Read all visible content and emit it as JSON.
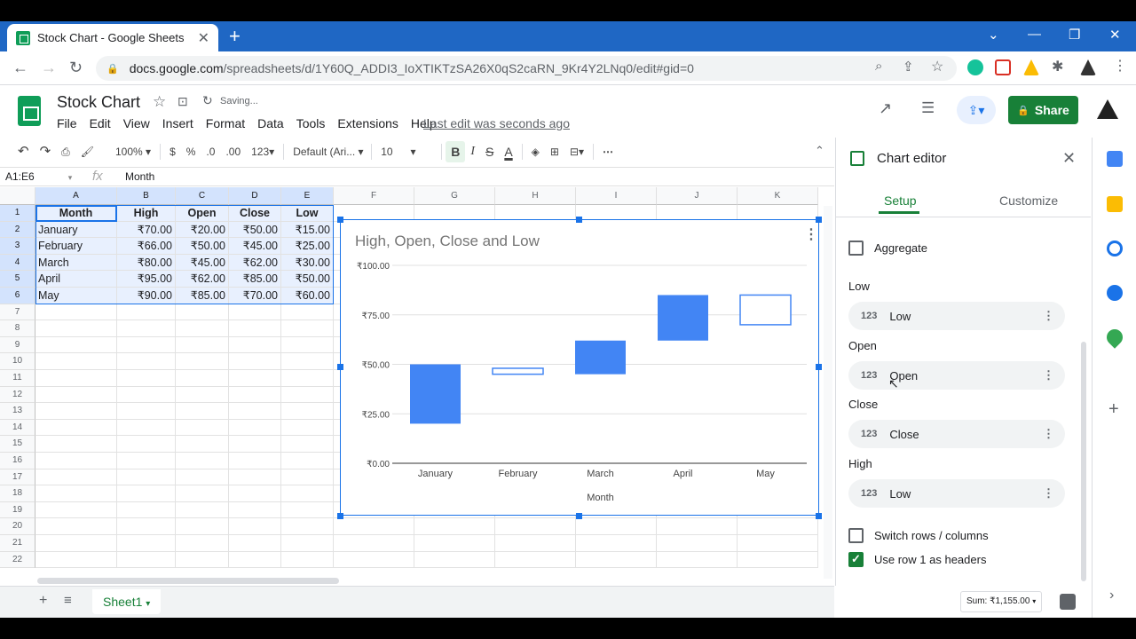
{
  "browser": {
    "tab_title": "Stock Chart - Google Sheets",
    "url_host": "docs.google.com",
    "url_path": "/spreadsheets/d/1Y60Q_ADDI3_IoXTIKTzSA26X0qS2caRN_9Kr4Y2LNq0/edit#gid=0"
  },
  "doc": {
    "title": "Stock Chart",
    "saving": "Saving...",
    "menus": [
      "File",
      "Edit",
      "View",
      "Insert",
      "Format",
      "Data",
      "Tools",
      "Extensions",
      "Help"
    ],
    "last_edit": "Last edit was seconds ago",
    "share_label": "Share"
  },
  "toolbar": {
    "zoom": "100%",
    "currency": "$",
    "percent": "%",
    "dec_less": ".0",
    "dec_more": ".00",
    "format": "123",
    "font": "Default (Ari...",
    "size": "10",
    "bold": "B",
    "italic": "I",
    "strike": "S",
    "textcolor": "A"
  },
  "formula": {
    "namebox": "A1:E6",
    "fx": "fx",
    "value": "Month"
  },
  "columns": [
    "A",
    "B",
    "C",
    "D",
    "E",
    "F",
    "G",
    "H",
    "I",
    "J",
    "K"
  ],
  "rows": [
    "1",
    "2",
    "3",
    "4",
    "5",
    "6",
    "7",
    "8",
    "9",
    "10",
    "11",
    "12",
    "13",
    "14",
    "15",
    "16",
    "17",
    "18",
    "19",
    "20",
    "21",
    "22"
  ],
  "table": {
    "headers": [
      "Month",
      "High",
      "Open",
      "Close",
      "Low"
    ],
    "rows": [
      [
        "January",
        "₹70.00",
        "₹20.00",
        "₹50.00",
        "₹15.00"
      ],
      [
        "February",
        "₹66.00",
        "₹50.00",
        "₹45.00",
        "₹25.00"
      ],
      [
        "March",
        "₹80.00",
        "₹45.00",
        "₹62.00",
        "₹30.00"
      ],
      [
        "April",
        "₹95.00",
        "₹62.00",
        "₹85.00",
        "₹50.00"
      ],
      [
        "May",
        "₹90.00",
        "₹85.00",
        "₹70.00",
        "₹60.00"
      ]
    ]
  },
  "chart_data": {
    "type": "candlestick",
    "title": "High, Open, Close and Low",
    "xlabel": "Month",
    "ylabel": "",
    "categories": [
      "January",
      "February",
      "March",
      "April",
      "May"
    ],
    "series": [
      {
        "name": "Low",
        "values": [
          15,
          25,
          30,
          50,
          60
        ]
      },
      {
        "name": "Open",
        "values": [
          20,
          50,
          45,
          62,
          85
        ]
      },
      {
        "name": "Close",
        "values": [
          50,
          45,
          62,
          85,
          70
        ]
      },
      {
        "name": "High",
        "values": [
          70,
          66,
          80,
          95,
          90
        ]
      }
    ],
    "rendered_boxes": [
      [
        20,
        50
      ],
      [
        48,
        45
      ],
      [
        45,
        62
      ],
      [
        62,
        85
      ],
      [
        85,
        70
      ]
    ],
    "y_ticks": [
      "₹0.00",
      "₹25.00",
      "₹50.00",
      "₹75.00",
      "₹100.00"
    ],
    "ylim": [
      0,
      100
    ],
    "grid": true,
    "colors": {
      "rising": "#4285f4",
      "falling_fill": "#ffffff",
      "falling_border": "#4285f4"
    }
  },
  "editor": {
    "title": "Chart editor",
    "tab_setup": "Setup",
    "tab_customize": "Customize",
    "aggregate": "Aggregate",
    "fields": [
      {
        "section": "Low",
        "value": "Low"
      },
      {
        "section": "Open",
        "value": "Open"
      },
      {
        "section": "Close",
        "value": "Close"
      },
      {
        "section": "High",
        "value": "Low"
      }
    ],
    "num_icon": "123",
    "switch_rows": "Switch rows / columns",
    "use_row1": "Use row 1 as headers"
  },
  "bottom": {
    "sheet": "Sheet1",
    "sum": "Sum: ₹1,155.00"
  },
  "colors": {
    "accent": "#1a73e8",
    "brand_green": "#188038",
    "chrome_blue": "#1f67c4"
  }
}
